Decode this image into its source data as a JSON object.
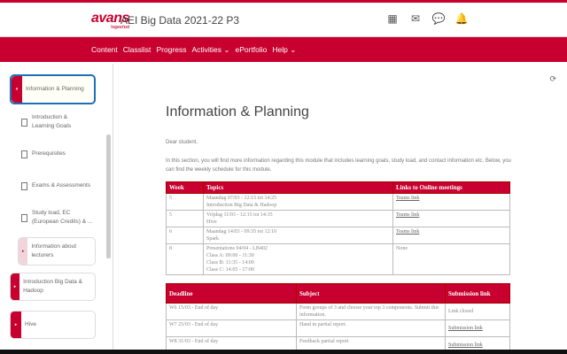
{
  "header": {
    "logo": "avans",
    "logo_sub": "hogeschool",
    "course_title": "AEI Big Data 2021-22 P3",
    "icons": [
      "apps-grid-icon",
      "mail-icon",
      "chat-icon",
      "bell-icon"
    ]
  },
  "nav": [
    "Content",
    "Classlist",
    "Progress",
    "Activities ⌄",
    "ePortfolio",
    "Help ⌄"
  ],
  "sidebar": {
    "active_unit": "Information & Planning",
    "topics": [
      "Introduction & Learning Goals",
      "Prerequisites",
      "Exams & Assessments",
      "Study load, EC (European Credits) & ..."
    ],
    "sub_unit": "Information about lecturers",
    "units": [
      "Introduction Big Data & Hadoop",
      "Hive"
    ]
  },
  "main": {
    "title": "Information & Planning",
    "greeting": "Dear student,",
    "intro": "In this section, you will find more information regarding this module that includes learning goals, study load, and contact information etc. Below, you can find the weekly schedule for this module.",
    "schedule": {
      "headers": [
        "Week",
        "Topics",
        "Links to Online meetings"
      ],
      "rows": [
        {
          "week": "5",
          "topic": [
            "Maandag 07/03 - 12:15 tot 14:25",
            "Introduction Big Data & Hadoop"
          ],
          "link": "Teams link"
        },
        {
          "week": "5",
          "topic": [
            "Vrijdag 11/03 - 12:15 tot 14:35",
            "Hive"
          ],
          "link": "Teams link"
        },
        {
          "week": "6",
          "topic": [
            "Maandag 14/03 - 09:35 tot 12:10",
            "Spark"
          ],
          "link": "Teams link"
        },
        {
          "week": "8",
          "topic": [
            "Presentations 04/04 - LB402",
            "Class A: 09:00 - 11:30",
            "Class B: 11:35 - 14:00",
            "Class C: 14:05 - 17:00"
          ],
          "link": "None"
        }
      ]
    },
    "deadlines": {
      "headers": [
        "Deadline",
        "Subject",
        "Submission link"
      ],
      "rows": [
        {
          "deadline": "W6 15/03 - End of day",
          "subject": "Form groups of 3 and choose your top 3 components. Submit this information.",
          "link": "Link closed"
        },
        {
          "deadline": "W7 25/03 - End of day",
          "subject": "Hand in partial report.",
          "link": "Submission link"
        },
        {
          "deadline": "W8 31/03 - End of day",
          "subject": "Feedback partial report",
          "link": "Submission link"
        }
      ]
    }
  }
}
